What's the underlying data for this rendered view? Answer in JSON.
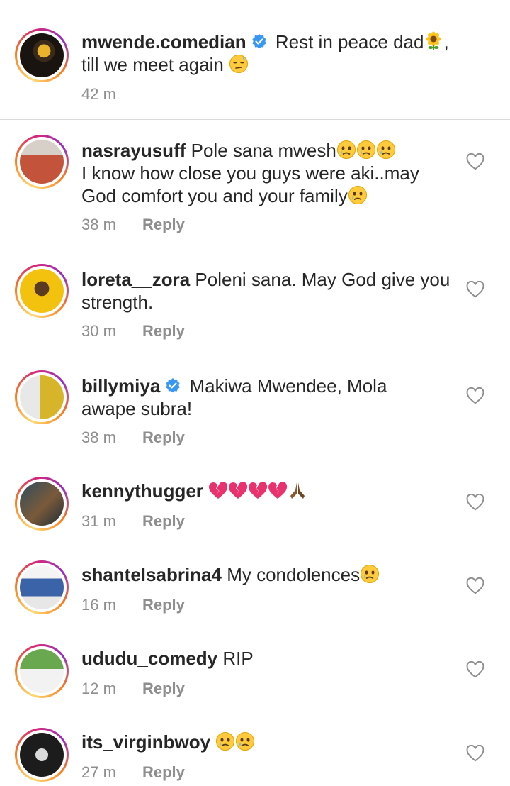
{
  "caption": {
    "username": "mwende.comedian",
    "text_line1": "Rest in peace dad",
    "after_emoji": ",",
    "text_line2": "till we meet again",
    "time": "42 m"
  },
  "reply_label": "Reply",
  "comments": [
    {
      "username": "nasrayusuff",
      "text1": "Pole sana mwesh",
      "text2": "I know how close you guys were aki..may",
      "text3": "God comfort you and your family",
      "time": "38 m"
    },
    {
      "username": "loreta__zora",
      "text1": "Poleni sana. May God give you",
      "text2": "strength.",
      "time": "30 m"
    },
    {
      "username": "billymiya",
      "text1": "Makiwa Mwendee, Mola",
      "text2": "awape subra!",
      "time": "38 m"
    },
    {
      "username": "kennythugger",
      "text1": "",
      "time": "31 m"
    },
    {
      "username": "shantelsabrina4",
      "text1": "My condolences",
      "time": "16 m"
    },
    {
      "username": "ududu_comedy",
      "text1": "RIP",
      "time": "12 m"
    },
    {
      "username": "its_virginbwoy",
      "text1": "",
      "time": "27 m"
    }
  ],
  "colors": {
    "text": "#262626",
    "muted": "#8e8e8e",
    "verified": "#3897f0",
    "heart_outline": "#8e8e8e"
  }
}
